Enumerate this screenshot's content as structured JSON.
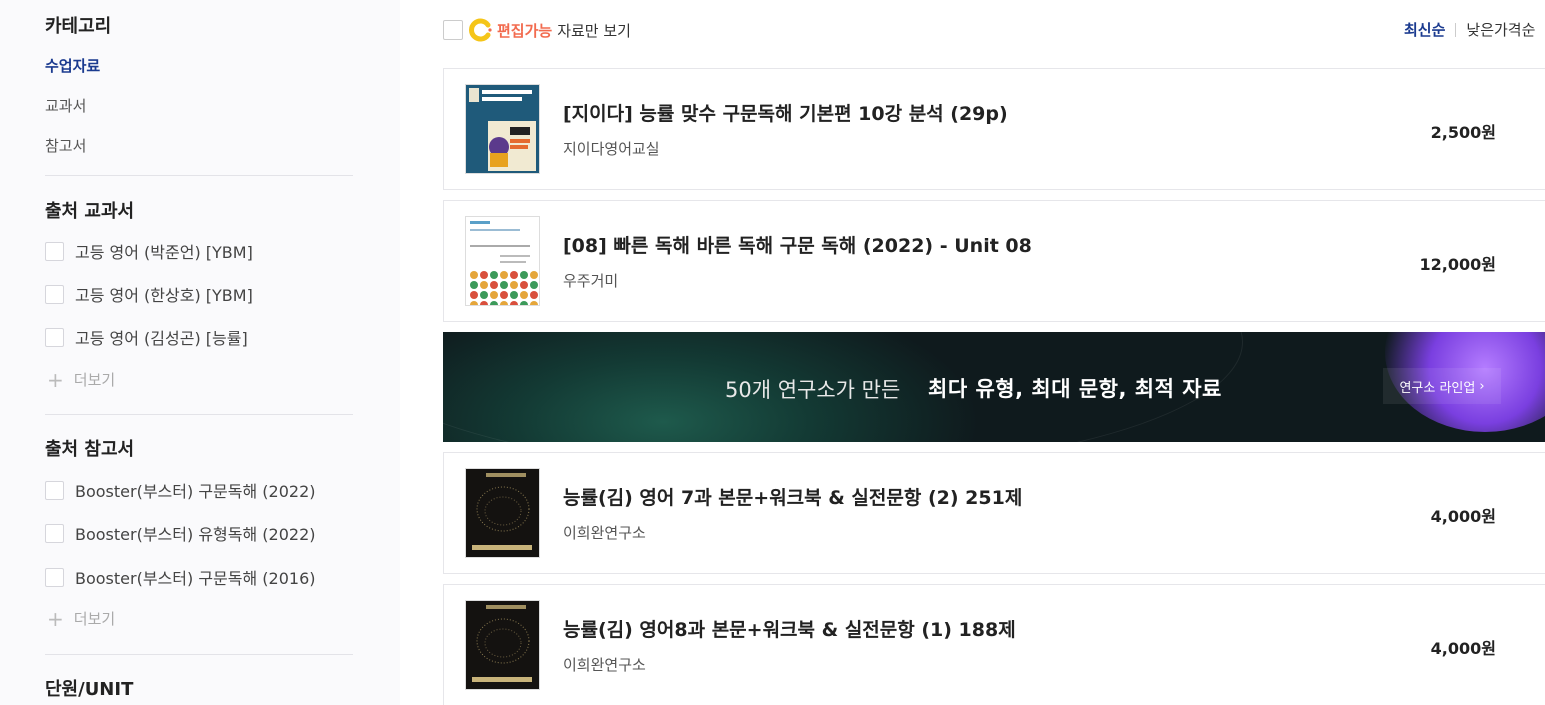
{
  "sidebar": {
    "category_title": "카테고리",
    "categories": [
      {
        "label": "수업자료",
        "active": true
      },
      {
        "label": "교과서",
        "active": false
      },
      {
        "label": "참고서",
        "active": false
      }
    ],
    "textbook_title": "출처 교과서",
    "textbooks": [
      "고등 영어 (박준언) [YBM]",
      "고등 영어 (한상호) [YBM]",
      "고등 영어 (김성곤) [능률]"
    ],
    "more_label": "더보기",
    "reference_title": "출처 참고서",
    "references": [
      "Booster(부스터) 구문독해 (2022)",
      "Booster(부스터) 유형독해 (2022)",
      "Booster(부스터) 구문독해 (2016)"
    ],
    "unit_title": "단원/UNIT"
  },
  "topbar": {
    "edit_label": "편집가능",
    "edit_suffix": "자료만 보기",
    "sort_active": "최신순",
    "sort_other": "낮은가격순"
  },
  "products": [
    {
      "title": "[지이다] 능률 맞수 구문독해 기본편 10강 분석 (29p)",
      "seller": "지이다영어교실",
      "price": "2,500원"
    },
    {
      "title": "[08] 빠른 독해 바른 독해 구문 독해 (2022) - Unit 08",
      "seller": "우주거미",
      "price": "12,000원"
    },
    {
      "title": "능률(김) 영어 7과 본문+워크북 & 실전문항 (2) 251제",
      "seller": "이희완연구소",
      "price": "4,000원"
    },
    {
      "title": "능률(김) 영어8과 본문+워크북 & 실전문항 (1) 188제",
      "seller": "이희완연구소",
      "price": "4,000원"
    }
  ],
  "banner": {
    "text": "50개 연구소가 만든",
    "strong": "최다 유형, 최대 문항, 최적 자료",
    "button": "연구소 라인업"
  },
  "colors": {
    "accent": "#1a3a8f",
    "edit": "#f26b4f",
    "c_icon": "#f5c518"
  }
}
